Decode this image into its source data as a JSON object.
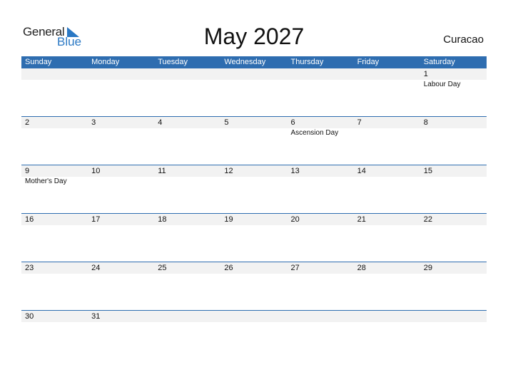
{
  "logo": {
    "line1": "General",
    "line2": "Blue",
    "accent": "#2a78c4"
  },
  "title": "May 2027",
  "country": "Curacao",
  "colors": {
    "header_bg": "#2e6db0",
    "band_bg": "#f2f2f2"
  },
  "weekdays": [
    "Sunday",
    "Monday",
    "Tuesday",
    "Wednesday",
    "Thursday",
    "Friday",
    "Saturday"
  ],
  "weeks": [
    [
      {
        "d": "",
        "h": ""
      },
      {
        "d": "",
        "h": ""
      },
      {
        "d": "",
        "h": ""
      },
      {
        "d": "",
        "h": ""
      },
      {
        "d": "",
        "h": ""
      },
      {
        "d": "",
        "h": ""
      },
      {
        "d": "1",
        "h": "Labour Day"
      }
    ],
    [
      {
        "d": "2",
        "h": ""
      },
      {
        "d": "3",
        "h": ""
      },
      {
        "d": "4",
        "h": ""
      },
      {
        "d": "5",
        "h": ""
      },
      {
        "d": "6",
        "h": "Ascension Day"
      },
      {
        "d": "7",
        "h": ""
      },
      {
        "d": "8",
        "h": ""
      }
    ],
    [
      {
        "d": "9",
        "h": "Mother's Day"
      },
      {
        "d": "10",
        "h": ""
      },
      {
        "d": "11",
        "h": ""
      },
      {
        "d": "12",
        "h": ""
      },
      {
        "d": "13",
        "h": ""
      },
      {
        "d": "14",
        "h": ""
      },
      {
        "d": "15",
        "h": ""
      }
    ],
    [
      {
        "d": "16",
        "h": ""
      },
      {
        "d": "17",
        "h": ""
      },
      {
        "d": "18",
        "h": ""
      },
      {
        "d": "19",
        "h": ""
      },
      {
        "d": "20",
        "h": ""
      },
      {
        "d": "21",
        "h": ""
      },
      {
        "d": "22",
        "h": ""
      }
    ],
    [
      {
        "d": "23",
        "h": ""
      },
      {
        "d": "24",
        "h": ""
      },
      {
        "d": "25",
        "h": ""
      },
      {
        "d": "26",
        "h": ""
      },
      {
        "d": "27",
        "h": ""
      },
      {
        "d": "28",
        "h": ""
      },
      {
        "d": "29",
        "h": ""
      }
    ],
    [
      {
        "d": "30",
        "h": ""
      },
      {
        "d": "31",
        "h": ""
      },
      {
        "d": "",
        "h": ""
      },
      {
        "d": "",
        "h": ""
      },
      {
        "d": "",
        "h": ""
      },
      {
        "d": "",
        "h": ""
      },
      {
        "d": "",
        "h": ""
      }
    ]
  ]
}
